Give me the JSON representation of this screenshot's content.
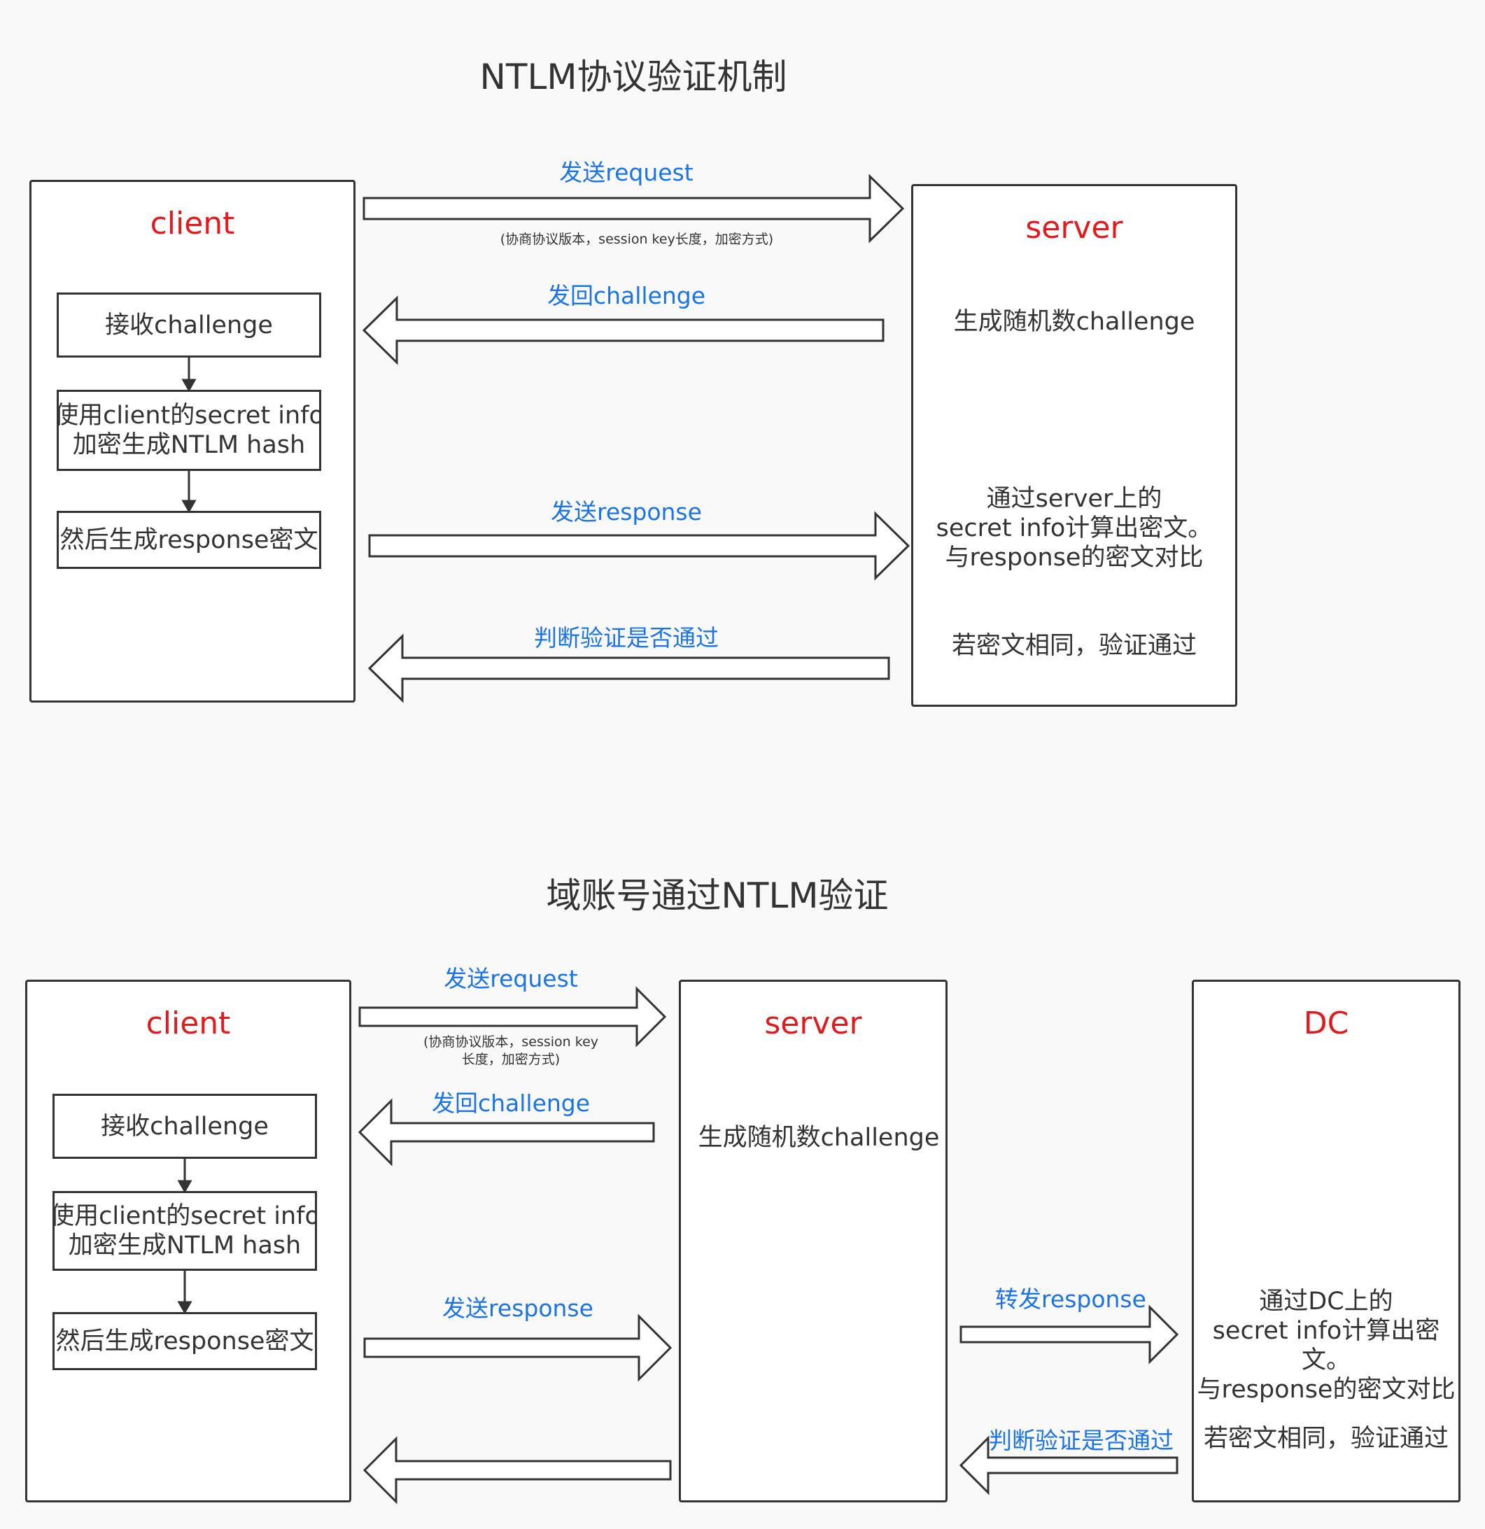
{
  "top": {
    "title": "NTLM协议验证机制",
    "client": {
      "label": "client",
      "step1": "接收challenge",
      "step2_line1": "使用client的secret info",
      "step2_line2": "加密生成NTLM hash",
      "step3": "然后生成response密文"
    },
    "server": {
      "label": "server",
      "text1": "生成随机数challenge",
      "text2": "通过server上的\nsecret info计算出密文。\n与response的密文对比",
      "text3": "若密文相同，验证通过"
    },
    "arrows": {
      "request": "发送request",
      "request_note": "(协商协议版本，session key长度，加密方式)",
      "challenge": "发回challenge",
      "response": "发送response",
      "verify": "判断验证是否通过"
    }
  },
  "bottom": {
    "title": "域账号通过NTLM验证",
    "client": {
      "label": "client",
      "step1": "接收challenge",
      "step2_line1": "使用client的secret info",
      "step2_line2": "加密生成NTLM hash",
      "step3": "然后生成response密文"
    },
    "server": {
      "label": "server",
      "text1": "生成随机数challenge"
    },
    "dc": {
      "label": "DC",
      "text1": "通过DC上的\nsecret info计算出密文。\n与response的密文对比",
      "text2": "若密文相同，验证通过"
    },
    "arrows": {
      "request": "发送request",
      "request_note": "(协商协议版本，session key\n长度，加密方式)",
      "challenge": "发回challenge",
      "response": "发送response",
      "forward": "转发response",
      "verify": "判断验证是否通过"
    }
  },
  "colors": {
    "title_red": "#e5191b",
    "label_blue": "#1b73e8",
    "line": "#333333"
  }
}
